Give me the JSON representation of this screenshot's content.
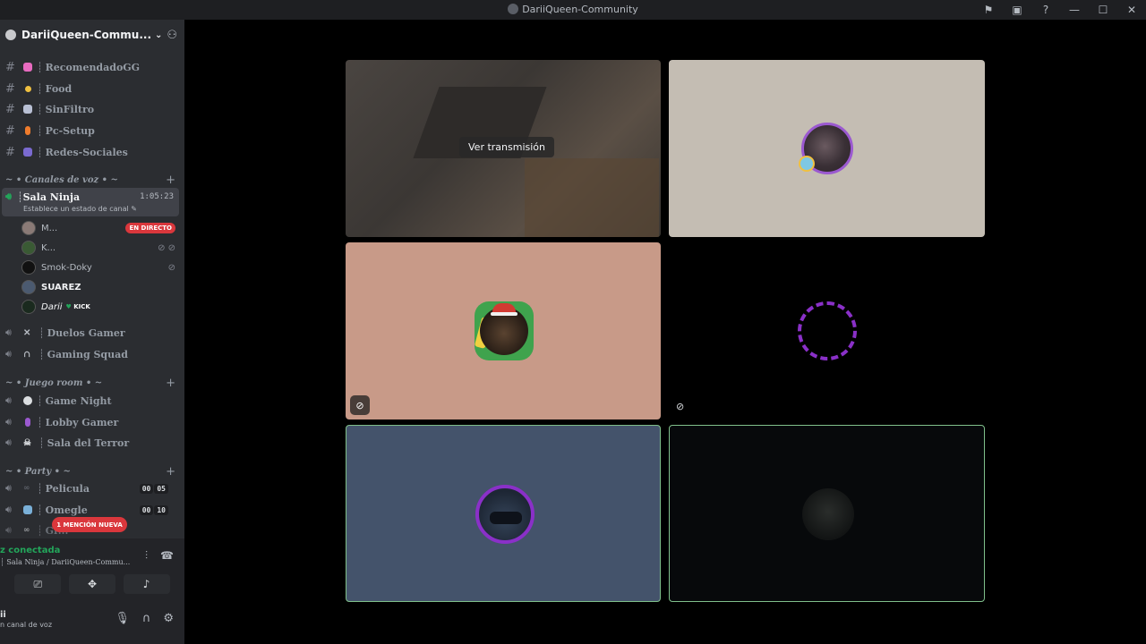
{
  "window": {
    "title": "DariiQueen-Community",
    "controls": [
      "⚑",
      "▣",
      "?",
      "—",
      "☐",
      "✕"
    ]
  },
  "server": {
    "name": "DariiQueen-Commu..."
  },
  "text_channels": [
    {
      "name": "RecomendadoGG",
      "emoji_color": "#e86bc0"
    },
    {
      "name": "Food",
      "emoji_color": "#f0c040"
    },
    {
      "name": "SinFiltro",
      "emoji_color": "#b9c0d4"
    },
    {
      "name": "Pc-Setup",
      "emoji_color": "#f07c2c"
    },
    {
      "name": "Redes-Sociales",
      "emoji_color": "#7a6ad0"
    }
  ],
  "categories": {
    "voice": "~ • Canales de voz • ~",
    "game": "~ • Juego room • ~",
    "party": "~ • Party • ~"
  },
  "active_channel": {
    "name": "Sala Ninja",
    "timer": "1:05:23",
    "status": "Establece un estado de canal"
  },
  "users": [
    {
      "name": "M...",
      "live": "EN DIRECTO",
      "avatar_color": "#8a7a76"
    },
    {
      "name": "K...",
      "icons": "⊘ ⊘",
      "avatar_color": "#3a5a34"
    },
    {
      "name": "Smok-Doky",
      "icons": "⊘",
      "avatar_color": "#111111"
    },
    {
      "name": "SUAREZ",
      "avatar_color": "#4b5a70"
    },
    {
      "name": "Darii",
      "tag": "KICK",
      "avatar_color": "#1a2a1e"
    }
  ],
  "voice_channels": [
    {
      "name": "Duelos Gamer",
      "emoji_color": "#b5bac1"
    },
    {
      "name": "Gaming Squad",
      "emoji_color": "#b5bac1"
    }
  ],
  "game_channels": [
    {
      "name": "Game Night",
      "emoji_color": "#dbdee1"
    },
    {
      "name": "Lobby Gamer",
      "emoji_color": "#9b59d0"
    },
    {
      "name": "Sala del Terror",
      "emoji_color": "#dbdee1"
    }
  ],
  "party_channels": [
    {
      "name": "Pelicula",
      "count_a": "00",
      "count_b": "05",
      "emoji_color": "#5a5e66"
    },
    {
      "name": "Omegle",
      "count_a": "00",
      "count_b": "10",
      "emoji_color": "#7ab0d8"
    },
    {
      "name": "Gr...",
      "emoji_color": "#dbdee1"
    }
  ],
  "mention_badge": "1 MENCIÓN NUEVA",
  "voice_panel": {
    "status": "z conectada",
    "channel": "Sala Ninja / DariiQueen-Commu..."
  },
  "user_bar": {
    "name": "ii",
    "status": "n canal de voz"
  },
  "stream_tile": {
    "watch_label": "Ver transmisión"
  }
}
